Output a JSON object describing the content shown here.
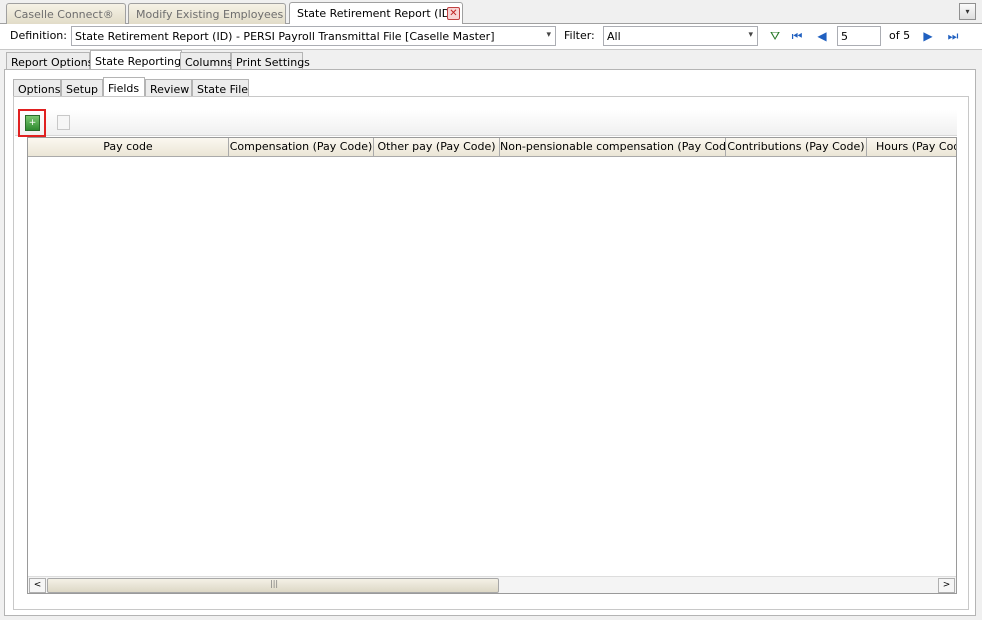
{
  "doc_tabs": [
    {
      "label": "Caselle Connect®"
    },
    {
      "label": "Modify Existing Employees"
    },
    {
      "label": "State Retirement Report (ID)"
    }
  ],
  "close_glyph": "✕",
  "definition": {
    "label": "Definition:",
    "value": "State Retirement Report (ID) - PERSI Payroll Transmittal File [Caselle Master]"
  },
  "filter": {
    "label": "Filter:",
    "value": "All"
  },
  "pager": {
    "current": "5",
    "of_text": "of 5"
  },
  "main_tabs": [
    "Report Options",
    "State Reporting",
    "Columns",
    "Print Settings"
  ],
  "sub_tabs": [
    "Options",
    "Setup",
    "Fields",
    "Review",
    "State File"
  ],
  "grid": {
    "columns": [
      "Pay code",
      "Compensation (Pay Code)",
      "Other pay (Pay Code)",
      "Non-pensionable compensation (Pay Code)",
      "Contributions (Pay Code)",
      "Hours (Pay Code)"
    ]
  },
  "icons": {
    "arrow_down": "▾",
    "first": "⏮",
    "prev": "◀",
    "next": "▶",
    "last": "⏭",
    "filter_add": "⛛",
    "scroll_left": "<",
    "scroll_right": ">",
    "grip": "|||"
  }
}
